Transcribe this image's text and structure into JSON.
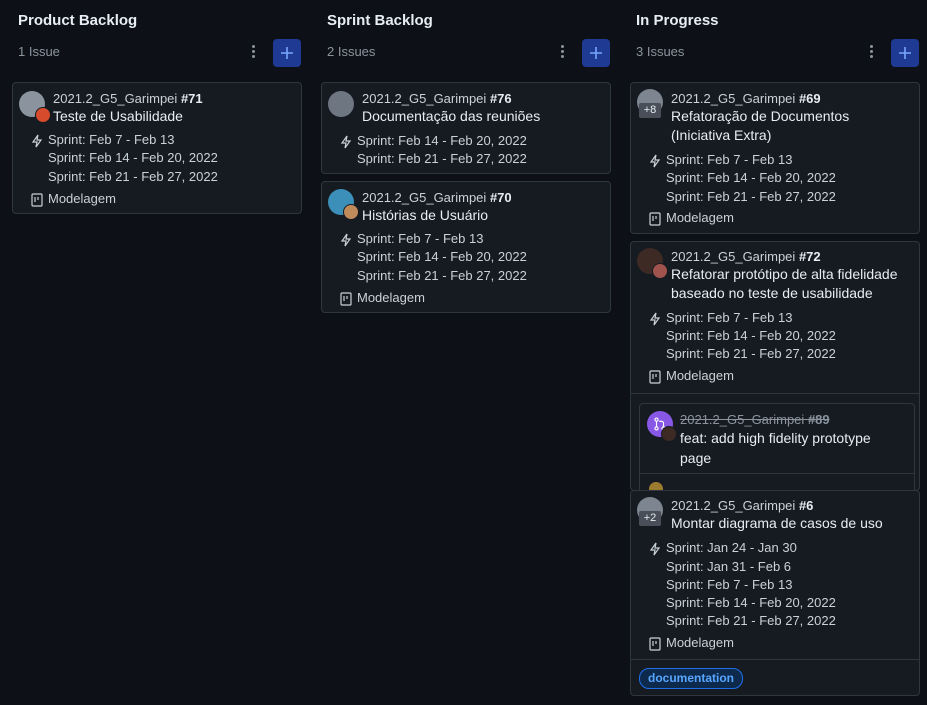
{
  "columns": [
    {
      "title": "Product Backlog",
      "count": "1 Issue"
    },
    {
      "title": "Sprint Backlog",
      "count": "2 Issues"
    },
    {
      "title": "In Progress",
      "count": "3 Issues"
    }
  ],
  "cards": {
    "c71": {
      "repo": "2021.2_G5_Garimpei",
      "number": "#71",
      "title": "Teste de Usabilidade",
      "sprints": [
        "Sprint: Feb 7 - Feb 13",
        "Sprint: Feb 14 - Feb 20, 2022",
        "Sprint: Feb 21 - Feb 27, 2022"
      ],
      "project": "Modelagem"
    },
    "c76": {
      "repo": "2021.2_G5_Garimpei",
      "number": "#76",
      "title": "Documentação das reuniões",
      "sprints": [
        "Sprint: Feb 14 - Feb 20, 2022",
        "Sprint: Feb 21 - Feb 27, 2022"
      ]
    },
    "c70": {
      "repo": "2021.2_G5_Garimpei",
      "number": "#70",
      "title": "Histórias de Usuário",
      "sprints": [
        "Sprint: Feb 7 - Feb 13",
        "Sprint: Feb 14 - Feb 20, 2022",
        "Sprint: Feb 21 - Feb 27, 2022"
      ],
      "project": "Modelagem"
    },
    "c69": {
      "repo": "2021.2_G5_Garimpei",
      "number": "#69",
      "title": "Refatoração de Documentos (Iniciativa Extra)",
      "assignee_extra": "+8",
      "sprints": [
        "Sprint: Feb 7 - Feb 13",
        "Sprint: Feb 14 - Feb 20, 2022",
        "Sprint: Feb 21 - Feb 27, 2022"
      ],
      "project": "Modelagem"
    },
    "c72": {
      "repo": "2021.2_G5_Garimpei",
      "number": "#72",
      "title": "Refatorar protótipo de alta fidelidade baseado no teste de usabilidade",
      "sprints": [
        "Sprint: Feb 7 - Feb 13",
        "Sprint: Feb 14 - Feb 20, 2022",
        "Sprint: Feb 21 - Feb 27, 2022"
      ],
      "project": "Modelagem",
      "linked_pr": {
        "repo": "2021.2_G5_Garimpei",
        "number": "#89",
        "title": "feat: add high fidelity prototype page"
      }
    },
    "c6": {
      "repo": "2021.2_G5_Garimpei",
      "number": "#6",
      "title": "Montar diagrama de casos de uso",
      "assignee_extra": "+2",
      "sprints": [
        "Sprint: Jan 24 - Jan 30",
        "Sprint: Jan 31 - Feb 6",
        "Sprint: Feb 7 - Feb 13",
        "Sprint: Feb 14 - Feb 20, 2022",
        "Sprint: Feb 21 - Feb 27, 2022"
      ],
      "project": "Modelagem",
      "label": "documentation"
    }
  },
  "colors": {
    "background": "#0d1117",
    "card": "#161b22",
    "border": "#30363d",
    "accent": "#1f3a93",
    "label": "#58a6ff",
    "pr": "#8957e5"
  },
  "icons": {
    "sprint": "lightning-icon",
    "project": "project-board-icon",
    "menu": "kebab-icon",
    "add": "plus-icon",
    "pr": "pull-request-icon"
  }
}
